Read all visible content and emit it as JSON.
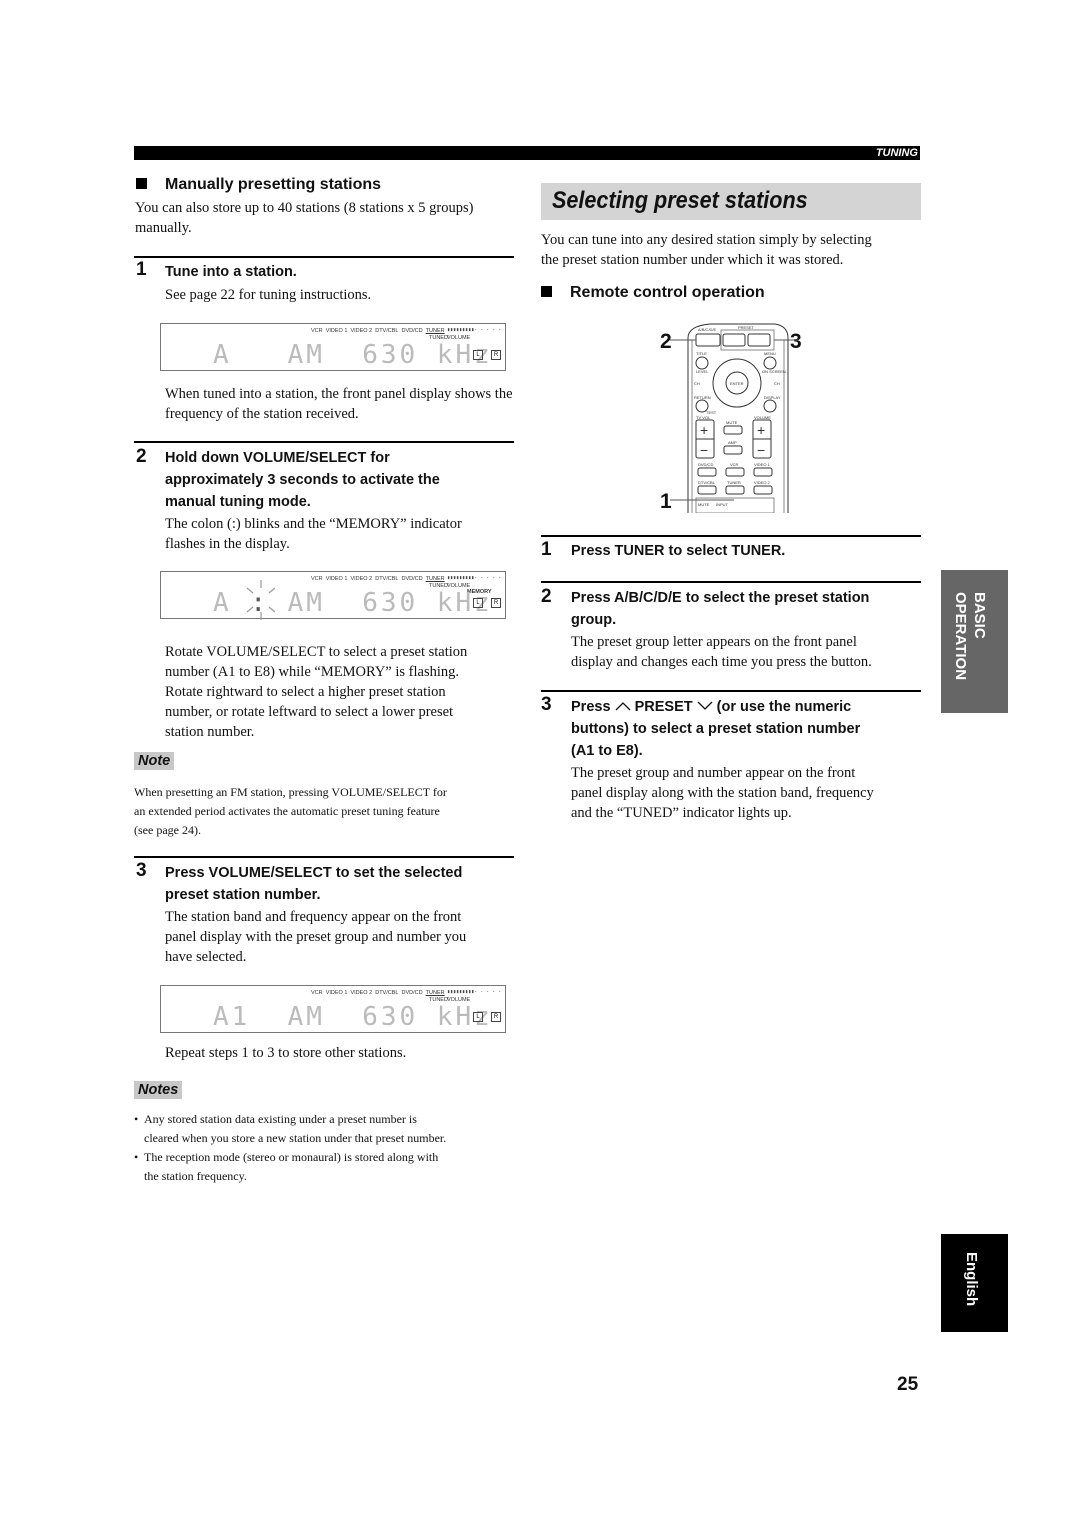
{
  "header": {
    "section_label": "TUNING"
  },
  "left": {
    "heading": "Manually presetting stations",
    "intro": "You can also store up to 40 stations (8 stations x 5 groups) manually.",
    "steps": [
      {
        "num": "1",
        "title": "Tune into a station.",
        "body": "See page 22 for tuning instructions.",
        "after": "When tuned into a station, the front panel display shows the frequency of the station received."
      },
      {
        "num": "2",
        "title_lines": [
          "Hold down VOLUME/SELECT for",
          "approximately 3 seconds to activate the",
          "manual tuning mode."
        ],
        "body_lines": [
          "The colon (:) blinks and the “MEMORY” indicator",
          "flashes in the display."
        ],
        "after_lines": [
          "Rotate VOLUME/SELECT to select a preset station",
          "number (A1 to E8) while “MEMORY” is flashing.",
          "Rotate rightward to select a higher preset station",
          "number, or rotate leftward to select a lower preset",
          "station number."
        ]
      },
      {
        "num": "3",
        "title_lines": [
          "Press VOLUME/SELECT to set the selected",
          "preset station number."
        ],
        "body_lines": [
          "The station band and frequency appear on the front",
          "panel display with the preset group and number you",
          "have selected."
        ],
        "after": "Repeat steps 1 to 3 to store other stations."
      }
    ],
    "note": {
      "label": "Note",
      "lines": [
        "When presetting an FM station, pressing VOLUME/SELECT for",
        "an extended period activates the automatic preset tuning feature",
        "(see page 24)."
      ]
    },
    "notes": {
      "label": "Notes",
      "items": [
        [
          "Any stored station data existing under a preset number is",
          "cleared when you store a new station under that preset number."
        ],
        [
          "The reception mode (stereo or monaural) is stored along with",
          "the station frequency."
        ]
      ]
    }
  },
  "displays": {
    "indicators": [
      "VCR",
      "VIDEO 1",
      "VIDEO 2",
      "DTV/CBL",
      "DVD/CD",
      "TUNER"
    ],
    "tuned": "TUNED",
    "volume": "VOLUME",
    "memory": "MEMORY",
    "left_ch": "L",
    "right_ch": "R",
    "d1": {
      "group": "A",
      "band": "AM",
      "freq": "630",
      "unit": "kHz"
    },
    "d2": {
      "group": "A",
      "colon": ":",
      "band": "AM",
      "freq": "630",
      "unit": "kHz"
    },
    "d3": {
      "group": "A1",
      "band": "AM",
      "freq": "630",
      "unit": "kHz"
    }
  },
  "right": {
    "title": "Selecting preset stations",
    "intro_lines": [
      "You can tune into any desired station simply by selecting",
      "the preset station number under which it was stored."
    ],
    "heading": "Remote control operation",
    "remote": {
      "callouts": [
        "2",
        "3",
        "1"
      ],
      "labels": {
        "abcde": "A/B/C/D/E",
        "preset": "PRESET",
        "title": "TITLE",
        "menu": "MENU",
        "level": "LEVEL",
        "on_screen": "ON SCREEN",
        "ch_minus": "CH",
        "ch_plus": "CH",
        "enter": "ENTER",
        "return": "RETURN",
        "display": "DISPLAY",
        "test": "TEST",
        "tv_vol": "TV VOL",
        "volume": "VOLUME",
        "mute": "MUTE",
        "amp": "AMP",
        "dvd_cd": "DVD/CD",
        "vcr": "VCR",
        "video1": "VIDEO 1",
        "dtv_cbl": "DTV/CBL",
        "tuner": "TUNER",
        "video2": "VIDEO 2",
        "tv_mute": "MUTE",
        "tv_input": "INPUT",
        "plus": "+",
        "minus": "−"
      }
    },
    "steps": [
      {
        "num": "1",
        "title": "Press TUNER to select TUNER."
      },
      {
        "num": "2",
        "title_lines": [
          "Press A/B/C/D/E to select the preset station",
          "group."
        ],
        "body_lines": [
          "The preset group letter appears on the front panel",
          "display and changes each time you press the button."
        ]
      },
      {
        "num": "3",
        "title_pre": "Press",
        "title_preset": "PRESET",
        "title_post": "(or use the numeric",
        "title_lines": [
          "buttons) to select a preset station number",
          "(A1 to E8)."
        ],
        "body_lines": [
          "The preset group and number appear on the front",
          "panel display along with the station band, frequency",
          "and the “TUNED” indicator lights up."
        ]
      }
    ]
  },
  "side_tabs": {
    "basic_line1": "BASIC",
    "basic_line2": "OPERATION",
    "language": "English"
  },
  "footer": {
    "page_number": "25"
  }
}
